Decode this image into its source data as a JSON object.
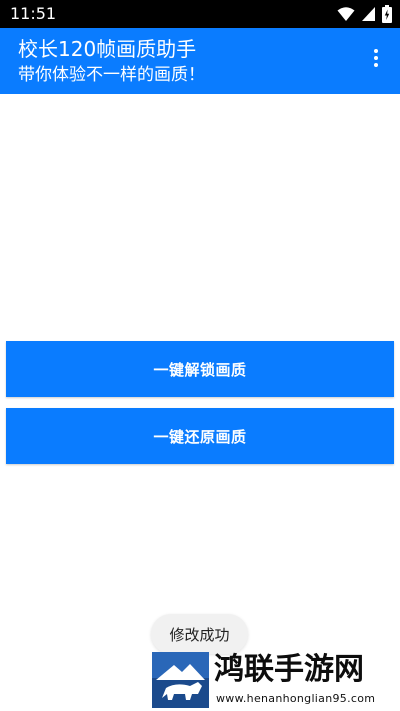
{
  "status_bar": {
    "time": "11:51"
  },
  "app_bar": {
    "title": "校长120帧画质助手",
    "subtitle": "带你体验不一样的画质！"
  },
  "buttons": {
    "unlock_label": "一键解锁画质",
    "restore_label": "一键还原画质"
  },
  "toast": {
    "message": "修改成功"
  },
  "watermark": {
    "name": "鸿联手游网",
    "url": "www.henanhonglian95.com"
  },
  "colors": {
    "accent": "#0a7cff",
    "status_bar": "#000000",
    "toast_bg": "#f1f1f1"
  }
}
